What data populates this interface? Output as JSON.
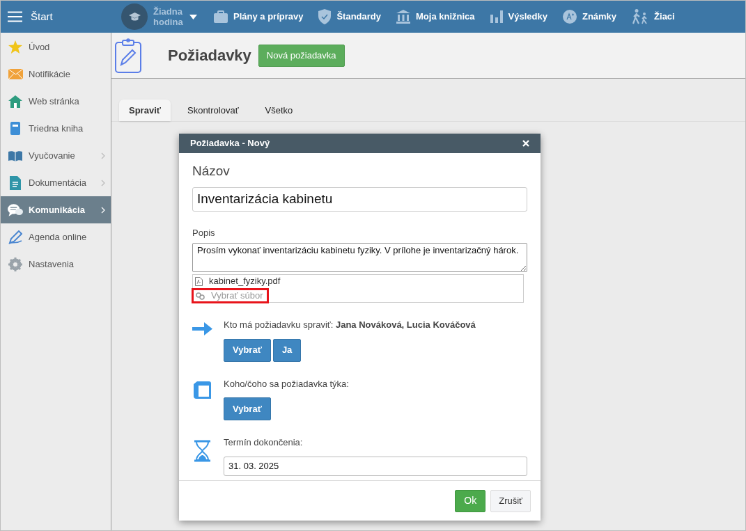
{
  "topbar": {
    "title": "Štart",
    "lesson": {
      "label": "Žiadna hodina"
    },
    "nav": [
      {
        "kind": "briefcase",
        "label": "Plány a prípravy"
      },
      {
        "kind": "shield",
        "label": "Štandardy"
      },
      {
        "kind": "library",
        "label": "Moja knižnica"
      },
      {
        "kind": "chart",
        "label": "Výsledky"
      },
      {
        "kind": "grade",
        "label": "Známky"
      },
      {
        "kind": "pupils",
        "label": "Žiaci"
      }
    ]
  },
  "sidebar": {
    "items": [
      {
        "kind": "star",
        "label": "Úvod",
        "selected": false,
        "expandable": false
      },
      {
        "kind": "mail",
        "label": "Notifikácie",
        "selected": false,
        "expandable": false
      },
      {
        "kind": "home",
        "label": "Web stránka",
        "selected": false,
        "expandable": false
      },
      {
        "kind": "book",
        "label": "Triedna kniha",
        "selected": false,
        "expandable": false
      },
      {
        "kind": "openbook",
        "label": "Vyučovanie",
        "selected": false,
        "expandable": true
      },
      {
        "kind": "doc",
        "label": "Dokumentácia",
        "selected": false,
        "expandable": true
      },
      {
        "kind": "chat",
        "label": "Komunikácia",
        "selected": true,
        "expandable": true
      },
      {
        "kind": "pen",
        "label": "Agenda online",
        "selected": false,
        "expandable": false
      },
      {
        "kind": "gear",
        "label": "Nastavenia",
        "selected": false,
        "expandable": false
      }
    ]
  },
  "page": {
    "title": "Požiadavky",
    "new_button": "Nová požiadavka",
    "tabs": [
      {
        "label": "Spraviť",
        "selected": true
      },
      {
        "label": "Skontrolovať",
        "selected": false
      },
      {
        "label": "Všetko",
        "selected": false
      }
    ]
  },
  "dialog": {
    "title": "Požiadavka - Nový",
    "name_label": "Názov",
    "name_value": "Inventarizácia kabinetu",
    "description_label": "Popis",
    "description_value": "Prosím vykonať inventarizáciu kabinetu fyziky. V prílohe je inventarizačný hárok.",
    "attachments": [
      {
        "kind": "file",
        "label": "kabinet_fyziky.pdf",
        "highlighted": false
      },
      {
        "kind": "link",
        "label": "Vybrať súbor",
        "highlighted": true
      }
    ],
    "sections": [
      {
        "kind": "assignees",
        "label": "Kto má požiadavku spraviť: **Jana Nováková, Lucia Kováčová**",
        "buttons": [
          "Vybrať",
          "Ja"
        ]
      },
      {
        "kind": "subject",
        "label": "Koho/čoho sa požiadavka týka:",
        "buttons": [
          "Vybrať"
        ]
      },
      {
        "kind": "deadline",
        "label": "Termín dokončenia:",
        "value": "31. 03. 2025"
      }
    ],
    "ok": "Ok",
    "cancel": "Zrušiť"
  }
}
